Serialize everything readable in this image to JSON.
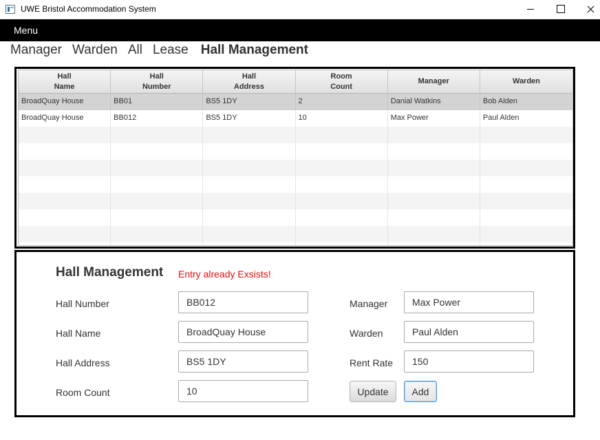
{
  "window": {
    "title": "UWE Bristol Accommodation System",
    "icon": "app-window-icon"
  },
  "menubar": {
    "menu_label": "Menu"
  },
  "nav": {
    "links": [
      "Manager",
      "Warden",
      "All",
      "Lease"
    ],
    "active": "Hall Management"
  },
  "table": {
    "columns": [
      "Hall\nName",
      "Hall\nNumber",
      "Hall\nAddress",
      "Room\nCount",
      "Manager",
      "Warden"
    ],
    "rows": [
      [
        "BroadQuay House",
        "BB01",
        "BS5 1DY",
        "2",
        "Danial Watkins",
        "Bob Alden"
      ],
      [
        "BroadQuay House",
        "BB012",
        "BS5 1DY",
        "10",
        "Max Power",
        "Paul Alden"
      ]
    ],
    "selected_row": 0
  },
  "form": {
    "title": "Hall Management",
    "error": "Entry already Exsists!",
    "hall_number_label": "Hall Number",
    "hall_number_value": "BB012",
    "hall_name_label": "Hall Name",
    "hall_name_value": "BroadQuay House",
    "hall_address_label": "Hall Address",
    "hall_address_value": "BS5 1DY",
    "room_count_label": "Room Count",
    "room_count_value": "10",
    "manager_label": "Manager",
    "manager_value": "Max Power",
    "warden_label": "Warden",
    "warden_value": "Paul Alden",
    "rent_rate_label": "Rent Rate",
    "rent_rate_value": "150",
    "update_label": "Update",
    "add_label": "Add"
  },
  "colors": {
    "menubar_bg": "#000000",
    "error_text": "#e01010",
    "focus_border": "#3c9ce6",
    "selected_row_bg": "#d3d3d3"
  }
}
